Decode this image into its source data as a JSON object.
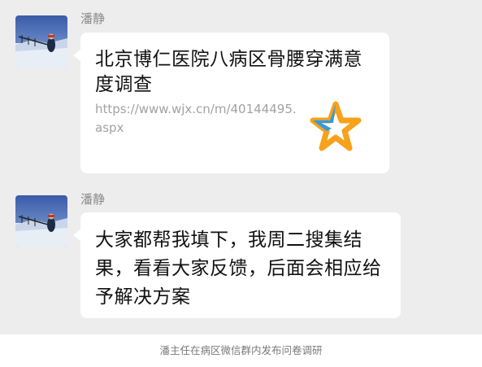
{
  "messages": [
    {
      "sender": "潘静",
      "type": "link",
      "title": "北京博仁医院八病区骨腰穿满意度调查",
      "url": "https://www.wjx.cn/m/40144495.aspx",
      "thumbnail_icon": "star-logo-icon"
    },
    {
      "sender": "潘静",
      "type": "text",
      "text": "大家都帮我填下，我周二搜集结果，看看大家反馈，后面会相应给予解决方案"
    }
  ],
  "caption": "潘主任在病区微信群内发布问卷调研",
  "colors": {
    "chat_background": "#ededed",
    "bubble": "#ffffff",
    "star_blue": "#2f9be3",
    "star_orange": "#f6a21a"
  }
}
